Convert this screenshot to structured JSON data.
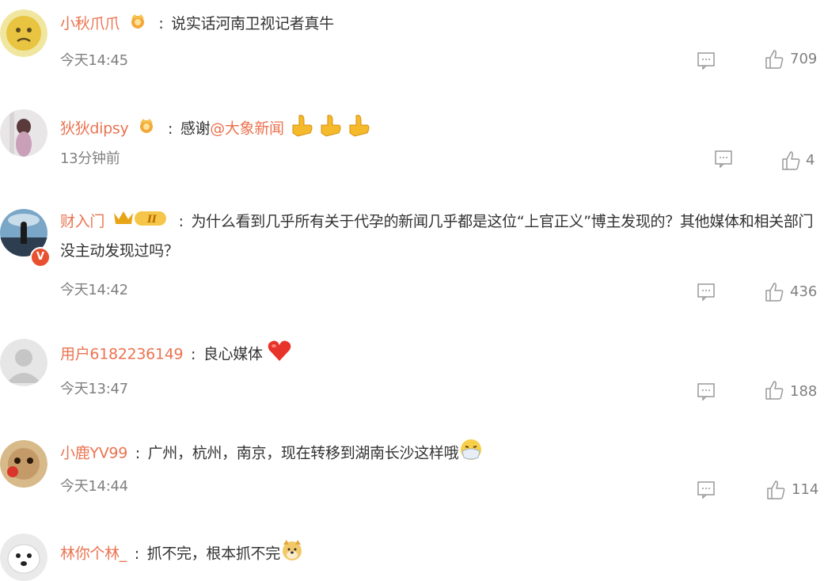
{
  "comments": [
    {
      "username": "小秋爪爪",
      "text": "说实话河南卫视记者真牛",
      "time": "今天14:45",
      "likes": "709",
      "icon": "crown-badge-icon"
    },
    {
      "username": "狄狄dipsy",
      "text_before": "感谢",
      "mention": "@大象新闻",
      "time": "13分钟前",
      "likes": "4",
      "icon": "crown-badge-icon",
      "emoji": "thumbs-up-emoji"
    },
    {
      "username": "财入门",
      "text": "为什么看到几乎所有关于代孕的新闻几乎都是这位“上官正义”博主发现的？其他媒体和相关部门没主动发现过吗？",
      "time": "今天14:42",
      "likes": "436",
      "icon": "vip-crown-level-badge-icon",
      "badge_level": "II",
      "verified": "V"
    },
    {
      "username": "用户6182236149",
      "text": "良心媒体",
      "time": "今天13:47",
      "likes": "188",
      "emoji": "heart-emoji"
    },
    {
      "username": "小鹿YV99",
      "text": "广州，杭州，南京，现在转移到湖南长沙这样哦",
      "time": "今天14:44",
      "likes": "114",
      "emoji": "mask-face-emoji"
    },
    {
      "username": "林你个林_",
      "text": "抓不完，根本抓不完",
      "emoji": "doge-emoji"
    }
  ],
  "colors": {
    "username": "#eb7350",
    "text": "#333333",
    "meta": "#808080"
  }
}
